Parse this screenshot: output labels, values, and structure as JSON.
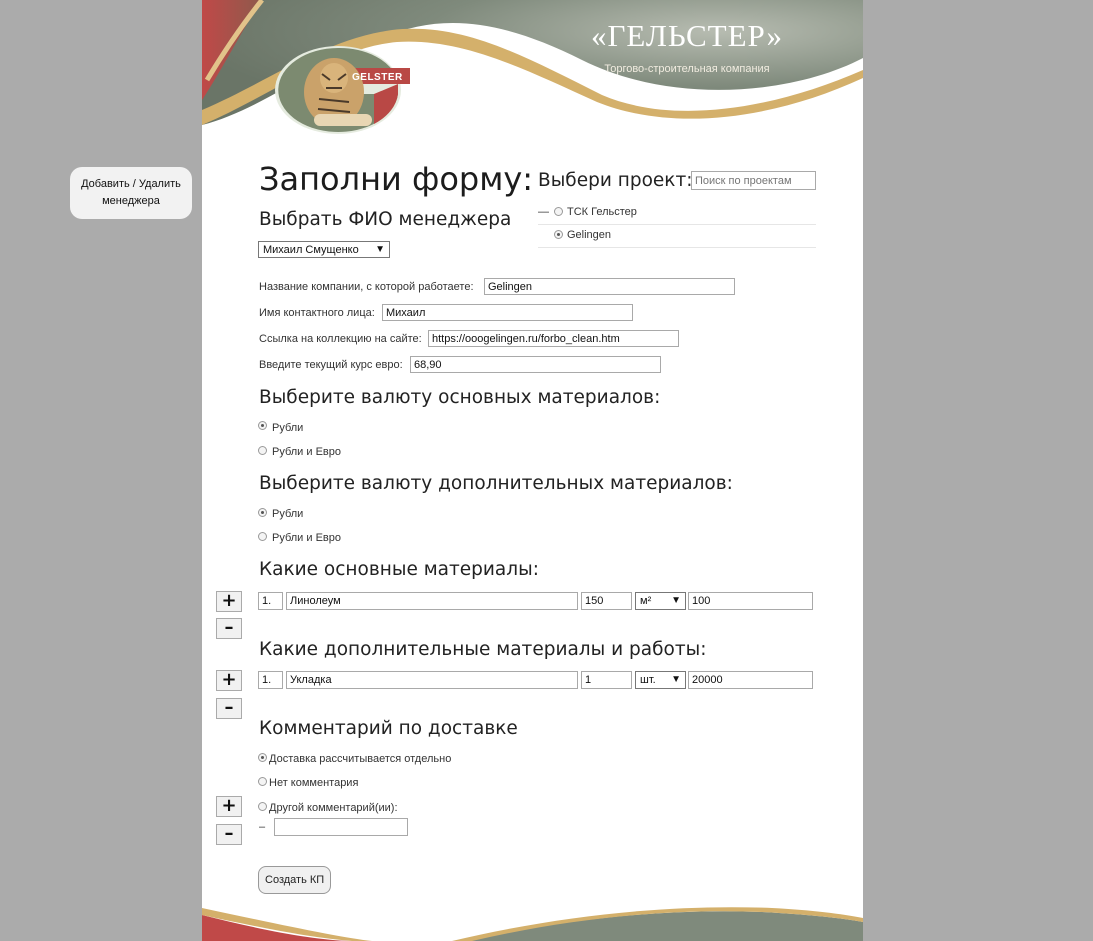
{
  "sidebar": {
    "manage_managers_label": "Добавить / Удалить менеджера"
  },
  "header": {
    "brand_title": "«ГЕЛЬСТЕР»",
    "brand_subtitle": "Торгово-строительная компания",
    "logo_text": "GELSTER"
  },
  "form": {
    "title": "Заполни форму:",
    "manager_heading": "Выбрать ФИО менеджера",
    "manager_select": "Михаил Смущенко",
    "company_label": "Название компании, с которой работаете:",
    "company_value": "Gelingen",
    "contact_label": "Имя контактного лица:",
    "contact_value": "Михаил",
    "link_label": "Ссылка на коллекцию на сайте:",
    "link_value": "https://ooogelingen.ru/forbo_clean.htm",
    "euro_label": "Введите текущий курс евро:",
    "euro_value": "68,90",
    "main_currency_heading": "Выберите валюту основных материалов:",
    "main_currency_options": [
      "Рубли",
      "Рубли и Евро"
    ],
    "extra_currency_heading": "Выберите валюту дополнительных материалов:",
    "extra_currency_options": [
      "Рубли",
      "Рубли и Евро"
    ],
    "main_materials_heading": "Какие основные материалы:",
    "main_row": {
      "num": "1.",
      "name": "Линолеум",
      "qty": "150",
      "unit": "м²",
      "price": "100"
    },
    "extra_materials_heading": "Какие дополнительные материалы и работы:",
    "extra_row": {
      "num": "1.",
      "name": "Укладка",
      "qty": "1",
      "unit": "шт.",
      "price": "20000"
    },
    "delivery_heading": "Комментарий по доставке",
    "delivery_options": [
      "Доставка рассчитывается отдельно",
      "Нет комментария",
      "Другой комментарий(ии):"
    ],
    "comment_dash": "–",
    "comment_value": "",
    "submit_label": "Создать КП"
  },
  "projects": {
    "heading": "Выбери проект:",
    "search_placeholder": "Поиск по проектам",
    "items": [
      {
        "prefix": "—",
        "label": "ТСК Гельстер"
      },
      {
        "prefix": "",
        "label": "Gelingen"
      }
    ]
  },
  "buttons": {
    "plus": "+",
    "minus": "–"
  }
}
